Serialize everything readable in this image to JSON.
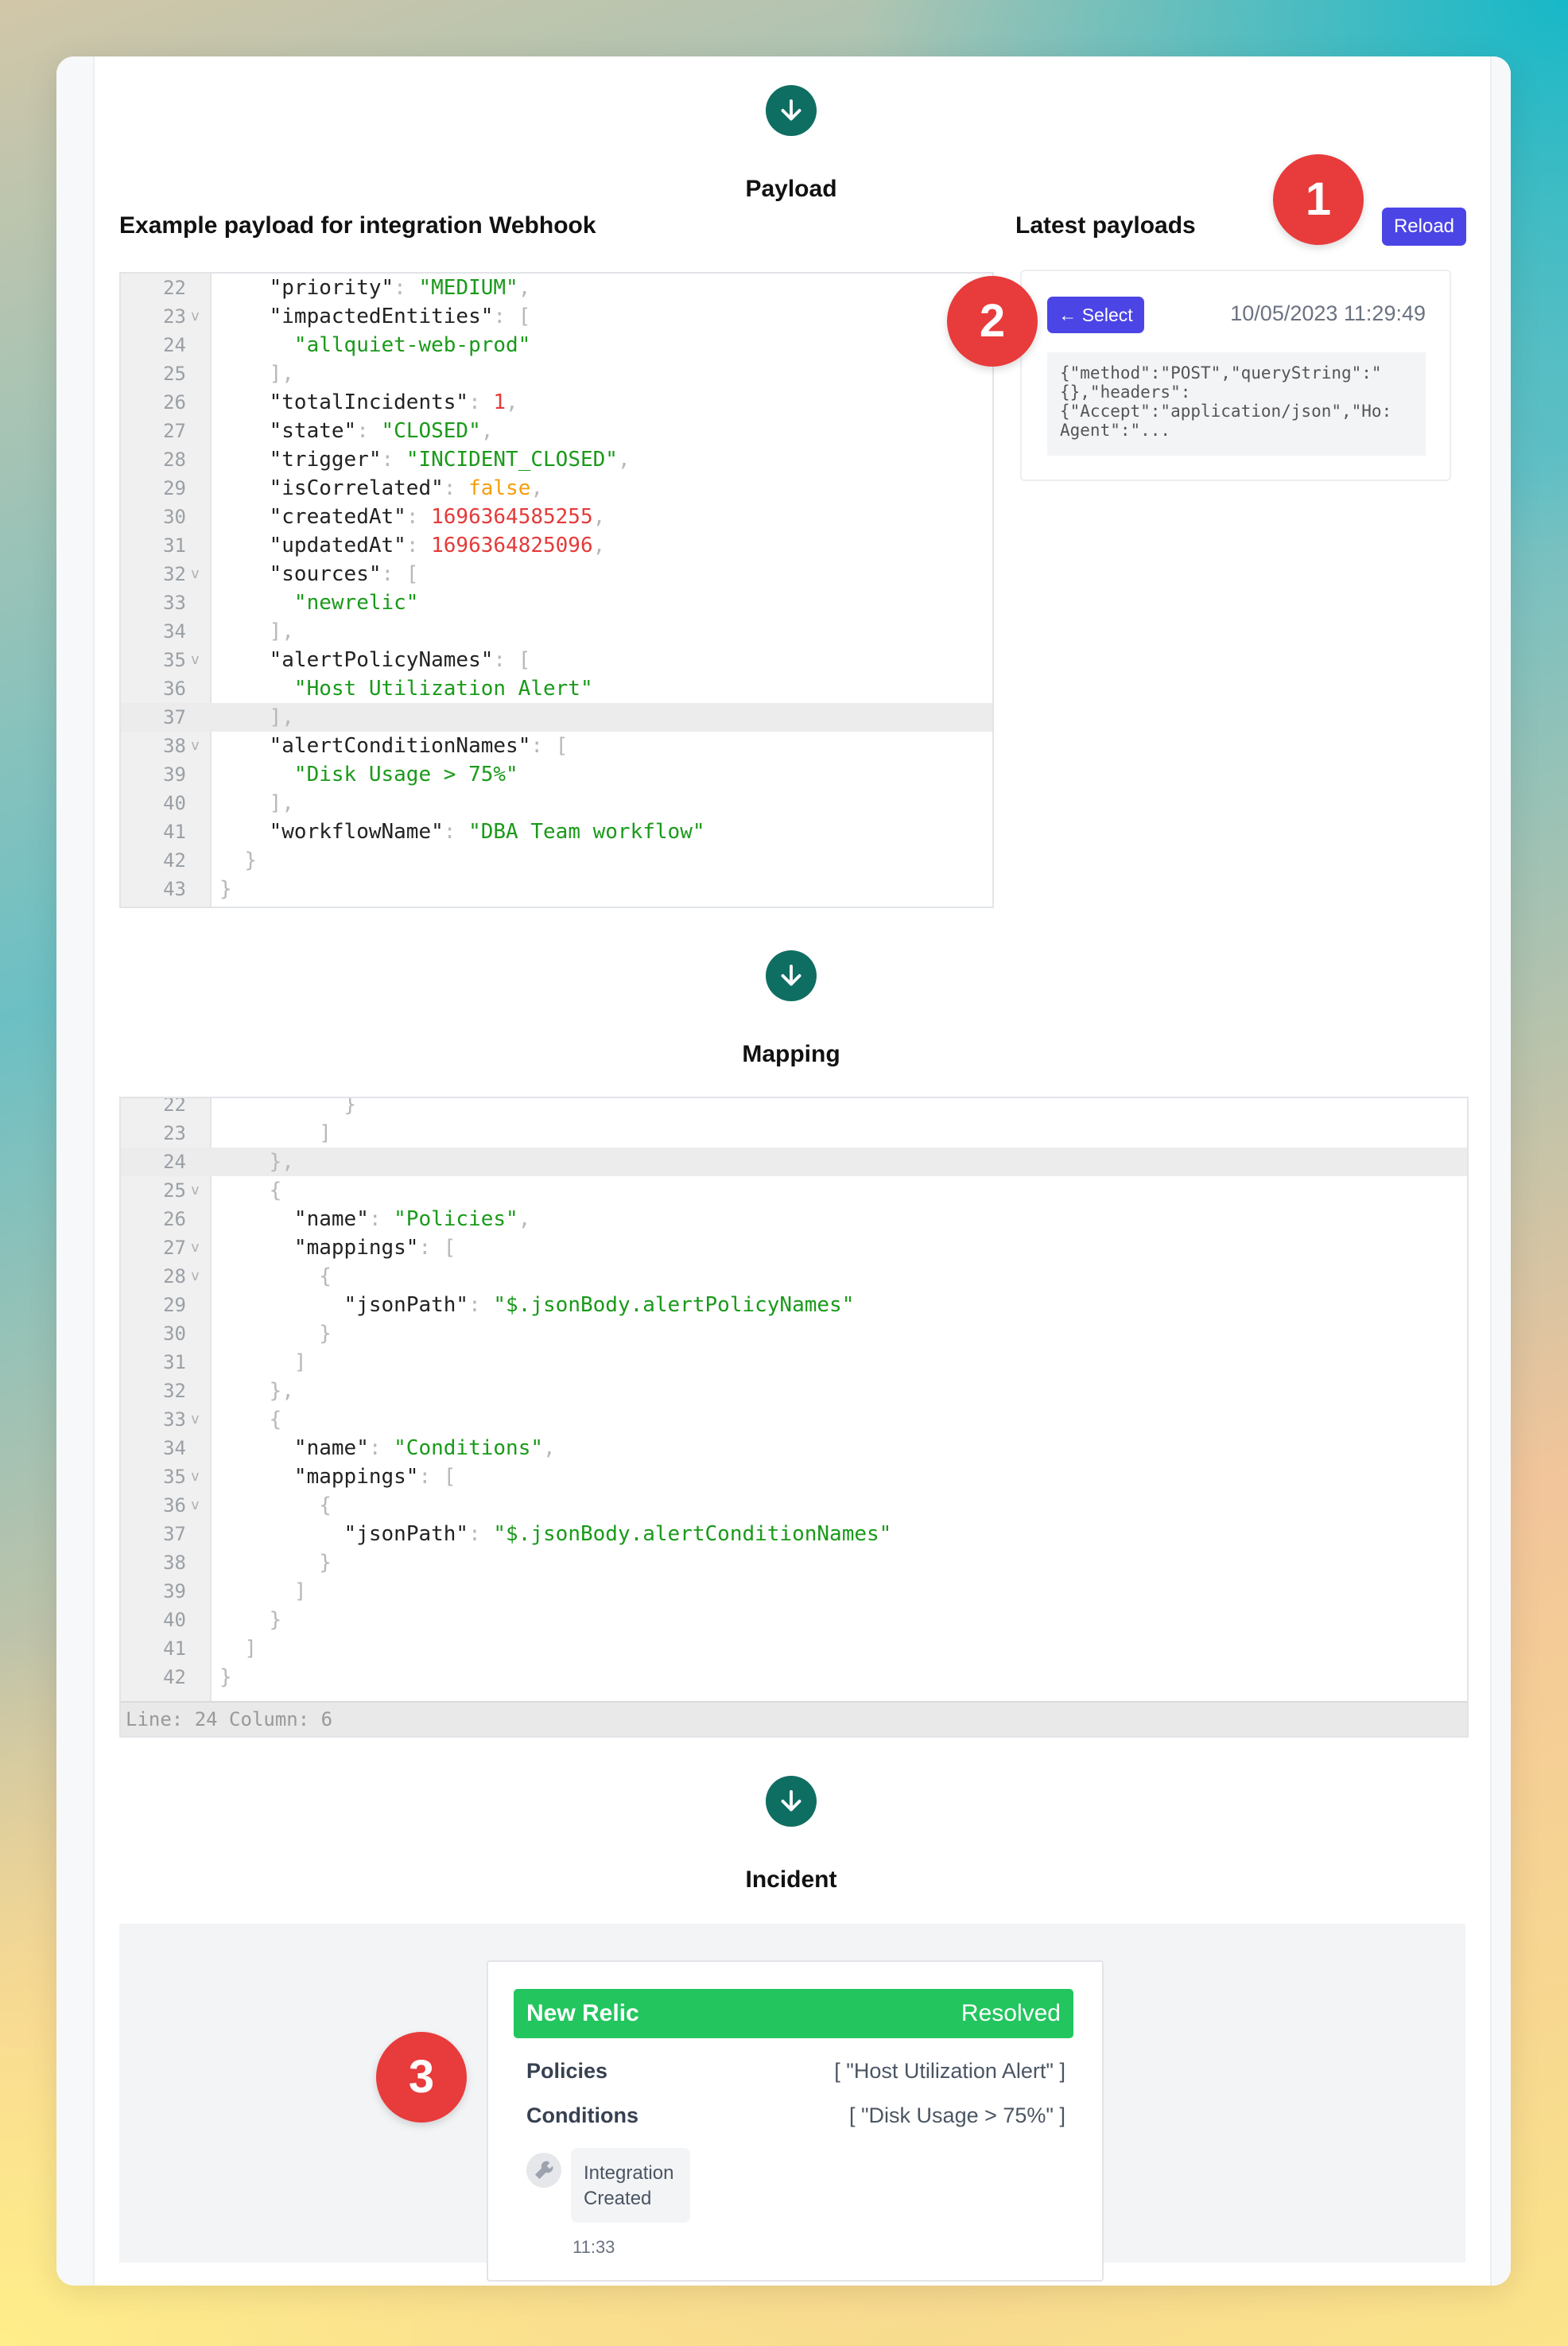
{
  "sections": {
    "payload": "Payload",
    "mapping": "Mapping",
    "incident": "Incident"
  },
  "payload_panel": {
    "example_title": "Example payload for integration Webhook",
    "latest_title": "Latest payloads",
    "reload_label": "Reload",
    "select_label": "← Select",
    "latest_timestamp": "10/05/2023 11:29:49",
    "latest_preview": "{\"method\":\"POST\",\"queryString\":\"\n{},\"headers\":\n{\"Accept\":\"application/json\",\"Ho:\nAgent\":\"..."
  },
  "payload_editor": {
    "lines": [
      {
        "n": "22",
        "fold": false,
        "html": "    <span>\"priority\"</span><span class='p'>: </span><span class='s'>\"MEDIUM\"</span><span class='p'>,</span>"
      },
      {
        "n": "23",
        "fold": true,
        "html": "    <span>\"impactedEntities\"</span><span class='p'>: [</span>"
      },
      {
        "n": "24",
        "fold": false,
        "html": "      <span class='s'>\"allquiet-web-prod\"</span>"
      },
      {
        "n": "25",
        "fold": false,
        "html": "    <span class='p'>],</span>"
      },
      {
        "n": "26",
        "fold": false,
        "html": "    <span>\"totalIncidents\"</span><span class='p'>: </span><span class='n'>1</span><span class='p'>,</span>"
      },
      {
        "n": "27",
        "fold": false,
        "html": "    <span>\"state\"</span><span class='p'>: </span><span class='s'>\"CLOSED\"</span><span class='p'>,</span>"
      },
      {
        "n": "28",
        "fold": false,
        "html": "    <span>\"trigger\"</span><span class='p'>: </span><span class='s'>\"INCIDENT_CLOSED\"</span><span class='p'>,</span>"
      },
      {
        "n": "29",
        "fold": false,
        "html": "    <span>\"isCorrelated\"</span><span class='p'>: </span><span class='b'>false</span><span class='p'>,</span>"
      },
      {
        "n": "30",
        "fold": false,
        "html": "    <span>\"createdAt\"</span><span class='p'>: </span><span class='n'>1696364585255</span><span class='p'>,</span>"
      },
      {
        "n": "31",
        "fold": false,
        "html": "    <span>\"updatedAt\"</span><span class='p'>: </span><span class='n'>1696364825096</span><span class='p'>,</span>"
      },
      {
        "n": "32",
        "fold": true,
        "html": "    <span>\"sources\"</span><span class='p'>: [</span>"
      },
      {
        "n": "33",
        "fold": false,
        "html": "      <span class='s'>\"newrelic\"</span>"
      },
      {
        "n": "34",
        "fold": false,
        "html": "    <span class='p'>],</span>"
      },
      {
        "n": "35",
        "fold": true,
        "html": "    <span>\"alertPolicyNames\"</span><span class='p'>: [</span>"
      },
      {
        "n": "36",
        "fold": false,
        "html": "      <span class='s'>\"Host Utilization Alert\"</span>"
      },
      {
        "n": "37",
        "fold": false,
        "active": true,
        "html": "    <span class='p'>],</span>"
      },
      {
        "n": "38",
        "fold": true,
        "html": "    <span>\"alertConditionNames\"</span><span class='p'>: [</span>"
      },
      {
        "n": "39",
        "fold": false,
        "html": "      <span class='s'>\"Disk Usage &gt; 75%\"</span>"
      },
      {
        "n": "40",
        "fold": false,
        "html": "    <span class='p'>],</span>"
      },
      {
        "n": "41",
        "fold": false,
        "html": "    <span>\"workflowName\"</span><span class='p'>: </span><span class='s'>\"DBA Team workflow\"</span>"
      },
      {
        "n": "42",
        "fold": false,
        "html": "  <span class='p'>}</span>"
      },
      {
        "n": "43",
        "fold": false,
        "html": "<span class='p'>}</span>"
      }
    ]
  },
  "mapping_editor": {
    "status": "Line: 24  Column: 6",
    "lines": [
      {
        "n": "22",
        "fold": false,
        "html": "          <span class='p'>}</span>"
      },
      {
        "n": "23",
        "fold": false,
        "html": "        <span class='p'>]</span>"
      },
      {
        "n": "24",
        "fold": false,
        "active": true,
        "html": "    <span class='p'>},</span>"
      },
      {
        "n": "25",
        "fold": true,
        "html": "    <span class='p'>{</span>"
      },
      {
        "n": "26",
        "fold": false,
        "html": "      <span>\"name\"</span><span class='p'>: </span><span class='s'>\"Policies\"</span><span class='p'>,</span>"
      },
      {
        "n": "27",
        "fold": true,
        "html": "      <span>\"mappings\"</span><span class='p'>: [</span>"
      },
      {
        "n": "28",
        "fold": true,
        "html": "        <span class='p'>{</span>"
      },
      {
        "n": "29",
        "fold": false,
        "html": "          <span>\"jsonPath\"</span><span class='p'>: </span><span class='s'>\"$.jsonBody.alertPolicyNames\"</span>"
      },
      {
        "n": "30",
        "fold": false,
        "html": "        <span class='p'>}</span>"
      },
      {
        "n": "31",
        "fold": false,
        "html": "      <span class='p'>]</span>"
      },
      {
        "n": "32",
        "fold": false,
        "html": "    <span class='p'>},</span>"
      },
      {
        "n": "33",
        "fold": true,
        "html": "    <span class='p'>{</span>"
      },
      {
        "n": "34",
        "fold": false,
        "html": "      <span>\"name\"</span><span class='p'>: </span><span class='s'>\"Conditions\"</span><span class='p'>,</span>"
      },
      {
        "n": "35",
        "fold": true,
        "html": "      <span>\"mappings\"</span><span class='p'>: [</span>"
      },
      {
        "n": "36",
        "fold": true,
        "html": "        <span class='p'>{</span>"
      },
      {
        "n": "37",
        "fold": false,
        "html": "          <span>\"jsonPath\"</span><span class='p'>: </span><span class='s'>\"$.jsonBody.alertConditionNames\"</span>"
      },
      {
        "n": "38",
        "fold": false,
        "html": "        <span class='p'>}</span>"
      },
      {
        "n": "39",
        "fold": false,
        "html": "      <span class='p'>]</span>"
      },
      {
        "n": "40",
        "fold": false,
        "html": "    <span class='p'>}</span>"
      },
      {
        "n": "41",
        "fold": false,
        "html": "  <span class='p'>]</span>"
      },
      {
        "n": "42",
        "fold": false,
        "html": "<span class='p'>}</span>"
      }
    ]
  },
  "incident": {
    "source": "New Relic",
    "status": "Resolved",
    "status_color": "#22c55e",
    "fields": [
      {
        "key": "Policies",
        "value": "[ \"Host Utilization Alert\" ]"
      },
      {
        "key": "Conditions",
        "value": "[ \"Disk Usage > 75%\" ]"
      }
    ],
    "timeline": {
      "icon": "wrench-icon",
      "label_line1": "Integration",
      "label_line2": "Created",
      "time": "11:33"
    }
  },
  "badges": [
    "1",
    "2",
    "3"
  ],
  "colors": {
    "accent": "#4b45e6",
    "arrow": "#0f6e62",
    "badge": "#e83b3b"
  }
}
